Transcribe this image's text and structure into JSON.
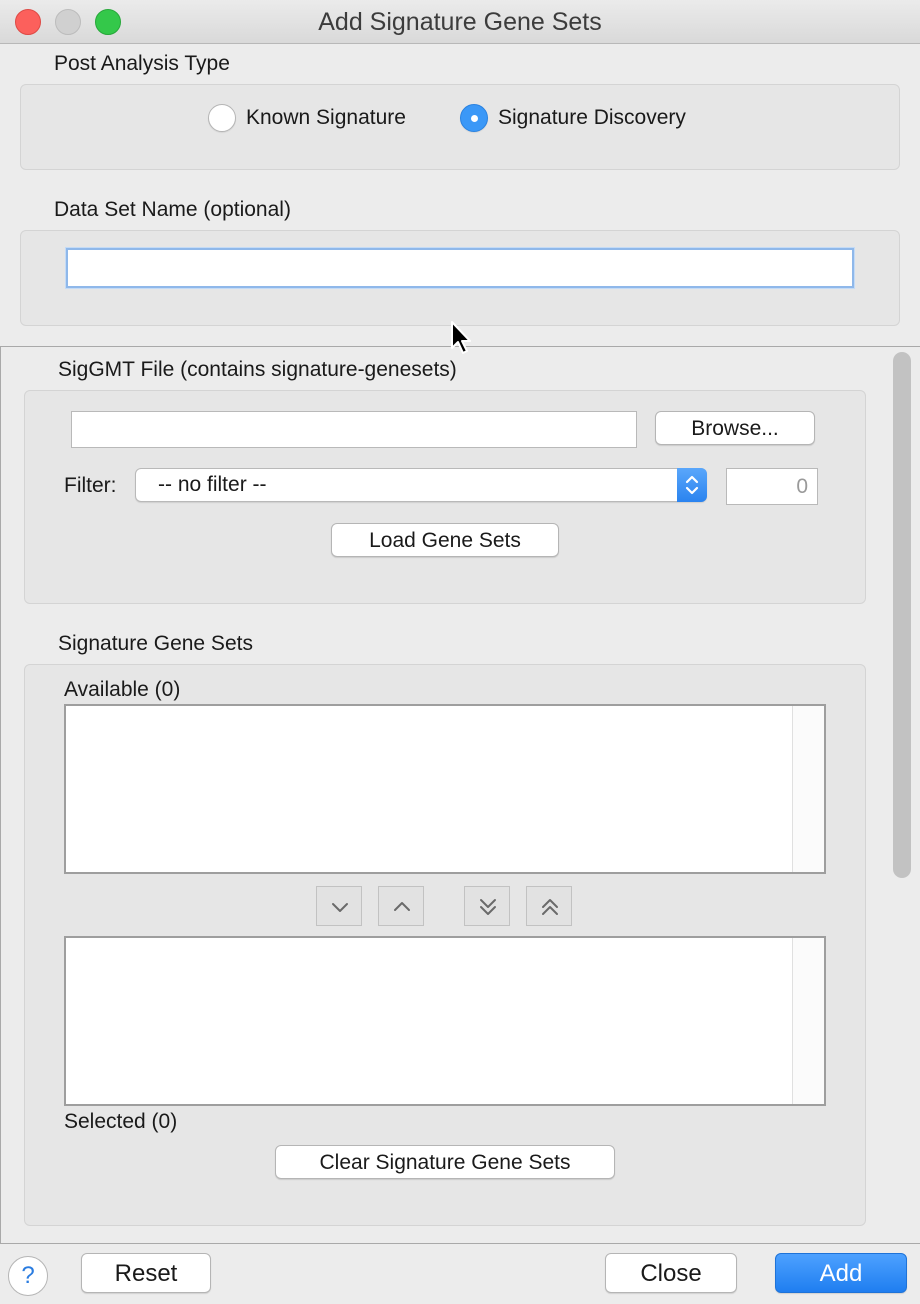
{
  "window": {
    "title": "Add Signature Gene Sets"
  },
  "post_analysis": {
    "section_label": "Post Analysis Type",
    "options": [
      "Known Signature",
      "Signature Discovery"
    ],
    "selected": "Signature Discovery"
  },
  "dataset": {
    "label": "Data Set Name (optional)",
    "value": ""
  },
  "siggmt": {
    "section_label": "SigGMT File (contains signature-genesets)",
    "file_value": "",
    "browse_label": "Browse...",
    "filter_label": "Filter:",
    "filter_value": "-- no filter --",
    "filter_number": "0",
    "load_label": "Load Gene Sets"
  },
  "genesets": {
    "section_label": "Signature Gene Sets",
    "available_label": "Available (0)",
    "selected_label": "Selected (0)",
    "clear_label": "Clear Signature Gene Sets",
    "move_icons": [
      "chevron-down-icon",
      "chevron-up-icon",
      "double-chevron-down-icon",
      "double-chevron-up-icon"
    ]
  },
  "footer": {
    "help_label": "?",
    "reset_label": "Reset",
    "close_label": "Close",
    "add_label": "Add"
  }
}
